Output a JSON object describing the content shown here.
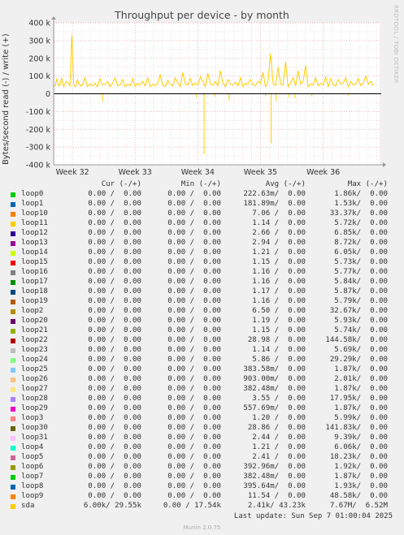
{
  "side_label": "RRDTOOL / TOBI OETIKER",
  "footer": {
    "last_update": "Last update: Sun Sep  7 01:00:04 2025",
    "munin": "Munin 2.0.75"
  },
  "legend_headers": {
    "cur": "Cur (-/+)",
    "min": "Min (-/+)",
    "avg": "Avg (-/+)",
    "max": "Max (-/+)"
  },
  "chart_data": {
    "type": "line",
    "title": "Throughput per device - by month",
    "ylabel": "Bytes/second read (-) / write (+)",
    "ylim": [
      -400000,
      400000
    ],
    "y_ticks": [
      -400000,
      -300000,
      -200000,
      -100000,
      0,
      100000,
      200000,
      300000,
      400000
    ],
    "y_tick_labels": [
      "-400 k",
      "-300 k",
      "-200 k",
      "-100 k",
      "0",
      "100 k",
      "200 k",
      "300 k",
      "400 k"
    ],
    "x_range_weeks": [
      31.7,
      36.9
    ],
    "x_ticks": [
      32,
      33,
      34,
      35,
      36
    ],
    "x_tick_labels": [
      "Week 32",
      "Week 33",
      "Week 34",
      "Week 35",
      "Week 36"
    ],
    "grid": true,
    "series": [
      {
        "name": "loop0",
        "color": "#00cc00",
        "cur": "0.00 /  0.00",
        "min": "0.00 /  0.00",
        "avg": "222.63m/  0.00",
        "max": "1.86k/  0.00"
      },
      {
        "name": "loop1",
        "color": "#0066b3",
        "cur": "0.00 /  0.00",
        "min": "0.00 /  0.00",
        "avg": "181.89m/  0.00",
        "max": "1.53k/  0.00"
      },
      {
        "name": "loop10",
        "color": "#ff8000",
        "cur": "0.00 /  0.00",
        "min": "0.00 /  0.00",
        "avg": "7.06 /  0.00",
        "max": "33.37k/  0.00"
      },
      {
        "name": "loop11",
        "color": "#ffcc00",
        "cur": "0.00 /  0.00",
        "min": "0.00 /  0.00",
        "avg": "1.14 /  0.00",
        "max": "5.72k/  0.00"
      },
      {
        "name": "loop12",
        "color": "#330099",
        "cur": "0.00 /  0.00",
        "min": "0.00 /  0.00",
        "avg": "2.66 /  0.00",
        "max": "6.85k/  0.00"
      },
      {
        "name": "loop13",
        "color": "#990099",
        "cur": "0.00 /  0.00",
        "min": "0.00 /  0.00",
        "avg": "2.94 /  0.00",
        "max": "8.72k/  0.00"
      },
      {
        "name": "loop14",
        "color": "#ccff00",
        "cur": "0.00 /  0.00",
        "min": "0.00 /  0.00",
        "avg": "1.21 /  0.00",
        "max": "6.05k/  0.00"
      },
      {
        "name": "loop15",
        "color": "#ff0000",
        "cur": "0.00 /  0.00",
        "min": "0.00 /  0.00",
        "avg": "1.15 /  0.00",
        "max": "5.73k/  0.00"
      },
      {
        "name": "loop16",
        "color": "#808080",
        "cur": "0.00 /  0.00",
        "min": "0.00 /  0.00",
        "avg": "1.16 /  0.00",
        "max": "5.77k/  0.00"
      },
      {
        "name": "loop17",
        "color": "#008f00",
        "cur": "0.00 /  0.00",
        "min": "0.00 /  0.00",
        "avg": "1.16 /  0.00",
        "max": "5.84k/  0.00"
      },
      {
        "name": "loop18",
        "color": "#00487d",
        "cur": "0.00 /  0.00",
        "min": "0.00 /  0.00",
        "avg": "1.17 /  0.00",
        "max": "5.87k/  0.00"
      },
      {
        "name": "loop19",
        "color": "#b35a00",
        "cur": "0.00 /  0.00",
        "min": "0.00 /  0.00",
        "avg": "1.16 /  0.00",
        "max": "5.79k/  0.00"
      },
      {
        "name": "loop2",
        "color": "#b38f00",
        "cur": "0.00 /  0.00",
        "min": "0.00 /  0.00",
        "avg": "6.50 /  0.00",
        "max": "32.67k/  0.00"
      },
      {
        "name": "loop20",
        "color": "#6b006b",
        "cur": "0.00 /  0.00",
        "min": "0.00 /  0.00",
        "avg": "1.19 /  0.00",
        "max": "5.93k/  0.00"
      },
      {
        "name": "loop21",
        "color": "#8fb300",
        "cur": "0.00 /  0.00",
        "min": "0.00 /  0.00",
        "avg": "1.15 /  0.00",
        "max": "5.74k/  0.00"
      },
      {
        "name": "loop22",
        "color": "#b30000",
        "cur": "0.00 /  0.00",
        "min": "0.00 /  0.00",
        "avg": "28.98 /  0.00",
        "max": "144.58k/  0.00"
      },
      {
        "name": "loop23",
        "color": "#bebebe",
        "cur": "0.00 /  0.00",
        "min": "0.00 /  0.00",
        "avg": "1.14 /  0.00",
        "max": "5.69k/  0.00"
      },
      {
        "name": "loop24",
        "color": "#80ff80",
        "cur": "0.00 /  0.00",
        "min": "0.00 /  0.00",
        "avg": "5.86 /  0.00",
        "max": "29.29k/  0.00"
      },
      {
        "name": "loop25",
        "color": "#80c9ff",
        "cur": "0.00 /  0.00",
        "min": "0.00 /  0.00",
        "avg": "383.58m/  0.00",
        "max": "1.87k/  0.00"
      },
      {
        "name": "loop26",
        "color": "#ffc080",
        "cur": "0.00 /  0.00",
        "min": "0.00 /  0.00",
        "avg": "903.00m/  0.00",
        "max": "2.01k/  0.00"
      },
      {
        "name": "loop27",
        "color": "#ffe680",
        "cur": "0.00 /  0.00",
        "min": "0.00 /  0.00",
        "avg": "382.48m/  0.00",
        "max": "1.87k/  0.00"
      },
      {
        "name": "loop28",
        "color": "#aa80ff",
        "cur": "0.00 /  0.00",
        "min": "0.00 /  0.00",
        "avg": "3.55 /  0.00",
        "max": "17.95k/  0.00"
      },
      {
        "name": "loop29",
        "color": "#ee00cc",
        "cur": "0.00 /  0.00",
        "min": "0.00 /  0.00",
        "avg": "557.69m/  0.00",
        "max": "1.87k/  0.00"
      },
      {
        "name": "loop3",
        "color": "#ff8080",
        "cur": "0.00 /  0.00",
        "min": "0.00 /  0.00",
        "avg": "1.20 /  0.00",
        "max": "5.99k/  0.00"
      },
      {
        "name": "loop30",
        "color": "#666600",
        "cur": "0.00 /  0.00",
        "min": "0.00 /  0.00",
        "avg": "28.86 /  0.00",
        "max": "141.83k/  0.00"
      },
      {
        "name": "loop31",
        "color": "#ffbfff",
        "cur": "0.00 /  0.00",
        "min": "0.00 /  0.00",
        "avg": "2.44 /  0.00",
        "max": "9.39k/  0.00"
      },
      {
        "name": "loop4",
        "color": "#00ffcc",
        "cur": "0.00 /  0.00",
        "min": "0.00 /  0.00",
        "avg": "1.21 /  0.00",
        "max": "6.06k/  0.00"
      },
      {
        "name": "loop5",
        "color": "#cc6699",
        "cur": "0.00 /  0.00",
        "min": "0.00 /  0.00",
        "avg": "2.41 /  0.00",
        "max": "18.23k/  0.00"
      },
      {
        "name": "loop6",
        "color": "#999900",
        "cur": "0.00 /  0.00",
        "min": "0.00 /  0.00",
        "avg": "392.96m/  0.00",
        "max": "1.92k/  0.00"
      },
      {
        "name": "loop7",
        "color": "#00cc00",
        "cur": "0.00 /  0.00",
        "min": "0.00 /  0.00",
        "avg": "382.48m/  0.00",
        "max": "1.87k/  0.00"
      },
      {
        "name": "loop8",
        "color": "#0066b3",
        "cur": "0.00 /  0.00",
        "min": "0.00 /  0.00",
        "avg": "395.64m/  0.00",
        "max": "1.93k/  0.00"
      },
      {
        "name": "loop9",
        "color": "#ff8000",
        "cur": "0.00 /  0.00",
        "min": "0.00 /  0.00",
        "avg": "11.54 /  0.00",
        "max": "48.58k/  0.00"
      },
      {
        "name": "sda",
        "color": "#ffcc00",
        "cur": "6.00k/ 29.55k",
        "min": "0.00 / 17.54k",
        "avg": "2.41k/ 43.23k",
        "max": "7.67M/  6.52M"
      }
    ],
    "sda_write_trace": {
      "week": [
        31.72,
        31.75,
        31.78,
        31.8,
        31.83,
        31.86,
        31.88,
        31.9,
        31.93,
        31.96,
        31.99,
        32.02,
        32.05,
        32.08,
        32.1,
        32.13,
        32.16,
        32.2,
        32.24,
        32.28,
        32.32,
        32.36,
        32.4,
        32.44,
        32.48,
        32.52,
        32.56,
        32.6,
        32.64,
        32.68,
        32.72,
        32.76,
        32.8,
        32.84,
        32.88,
        32.92,
        32.96,
        33.0,
        33.04,
        33.08,
        33.12,
        33.16,
        33.2,
        33.24,
        33.28,
        33.32,
        33.36,
        33.4,
        33.44,
        33.48,
        33.52,
        33.56,
        33.6,
        33.64,
        33.68,
        33.72,
        33.76,
        33.8,
        33.84,
        33.88,
        33.92,
        33.96,
        34.0,
        34.04,
        34.08,
        34.12,
        34.16,
        34.2,
        34.24,
        34.28,
        34.32,
        34.36,
        34.4,
        34.44,
        34.48,
        34.52,
        34.56,
        34.6,
        34.64,
        34.68,
        34.72,
        34.76,
        34.8,
        34.84,
        34.88,
        34.92,
        34.96,
        35.0,
        35.04,
        35.08,
        35.12,
        35.16,
        35.2,
        35.24,
        35.28,
        35.32,
        35.36,
        35.4,
        35.44,
        35.48,
        35.52,
        35.56,
        35.6,
        35.64,
        35.68,
        35.72,
        35.76,
        35.8,
        35.84,
        35.88,
        35.92,
        35.96,
        36.0,
        36.04,
        36.08,
        36.12,
        36.16,
        36.2,
        36.24,
        36.28,
        36.32,
        36.36,
        36.4,
        36.44,
        36.48,
        36.52,
        36.56,
        36.6,
        36.64,
        36.68,
        36.72,
        36.76,
        36.8,
        36.84,
        36.88
      ],
      "value": [
        40000,
        85000,
        45000,
        50000,
        90000,
        40000,
        55000,
        70000,
        60000,
        45000,
        330000,
        50000,
        40000,
        80000,
        60000,
        45000,
        50000,
        90000,
        40000,
        55000,
        45000,
        60000,
        40000,
        85000,
        50000,
        55000,
        70000,
        40000,
        60000,
        90000,
        45000,
        50000,
        80000,
        40000,
        55000,
        45000,
        85000,
        40000,
        60000,
        50000,
        70000,
        45000,
        90000,
        40000,
        55000,
        45000,
        60000,
        105000,
        50000,
        40000,
        75000,
        55000,
        45000,
        90000,
        60000,
        40000,
        120000,
        55000,
        50000,
        85000,
        45000,
        60000,
        50000,
        95000,
        70000,
        40000,
        115000,
        55000,
        50000,
        70000,
        45000,
        130000,
        60000,
        40000,
        80000,
        55000,
        50000,
        65000,
        45000,
        90000,
        40000,
        60000,
        55000,
        80000,
        50000,
        45000,
        70000,
        60000,
        120000,
        40000,
        70000,
        225000,
        60000,
        45000,
        150000,
        55000,
        50000,
        180000,
        40000,
        60000,
        90000,
        45000,
        130000,
        55000,
        70000,
        160000,
        40000,
        55000,
        50000,
        90000,
        45000,
        60000,
        50000,
        95000,
        40000,
        85000,
        50000,
        45000,
        80000,
        55000,
        60000,
        90000,
        40000,
        70000,
        50000,
        55000,
        85000,
        45000,
        60000,
        100000,
        55000,
        70000,
        45000
      ]
    },
    "sda_read_spikes": [
      {
        "week": 32.48,
        "value": -45000
      },
      {
        "week": 33.98,
        "value": -20000
      },
      {
        "week": 34.1,
        "value": -340000
      },
      {
        "week": 34.27,
        "value": -15000
      },
      {
        "week": 34.5,
        "value": -40000
      },
      {
        "week": 35.08,
        "value": -15000
      },
      {
        "week": 35.17,
        "value": -280000
      },
      {
        "week": 35.25,
        "value": -40000
      },
      {
        "week": 35.45,
        "value": -20000
      },
      {
        "week": 35.55,
        "value": -25000
      },
      {
        "week": 35.82,
        "value": -15000
      },
      {
        "week": 36.4,
        "value": -10000
      }
    ]
  }
}
